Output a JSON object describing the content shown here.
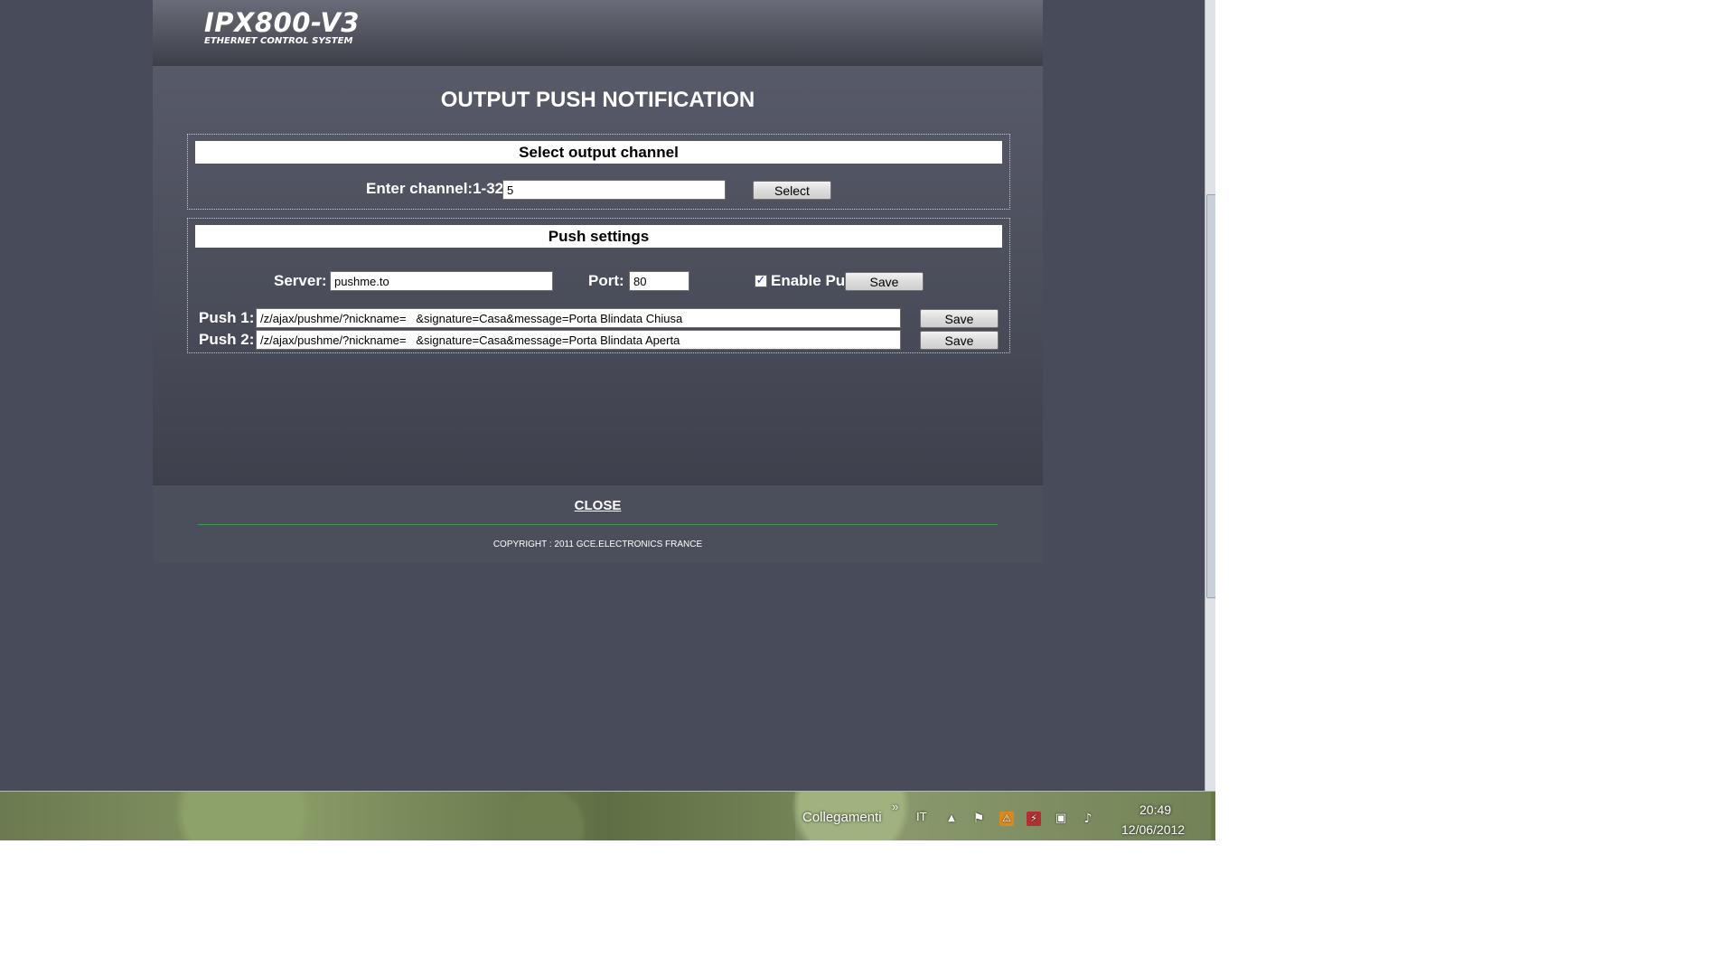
{
  "logo": {
    "title": "IPX800-V3",
    "subtitle": "ETHERNET CONTROL SYSTEM"
  },
  "page": {
    "title": "OUTPUT PUSH NOTIFICATION"
  },
  "channel_section": {
    "header": "Select output channel",
    "label": "Enter channel:1-32",
    "value": "5",
    "select_button": "Select"
  },
  "push_section": {
    "header": "Push settings",
    "server_label": "Server:",
    "server_value": "pushme.to",
    "port_label": "Port:",
    "port_value": "80",
    "enable_label": "Enable Push",
    "enable_checked": true,
    "save_button": "Save",
    "push1_label": "Push 1:",
    "push1_value": "/z/ajax/pushme/?nickname=   &signature=Casa&message=Porta Blindata Chiusa",
    "push1_save": "Save",
    "push2_label": "Push 2:",
    "push2_value": "/z/ajax/pushme/?nickname=   &signature=Casa&message=Porta Blindata Aperta",
    "push2_save": "Save"
  },
  "footer": {
    "close_link": "CLOSE",
    "copyright": "COPYRIGHT : 2011 GCE.ELECTRONICS FRANCE"
  },
  "taskbar": {
    "toolbar_label": "Collegamenti",
    "toolbar_chevron": "»",
    "language": "IT",
    "time": "20:49",
    "date": "12/06/2012",
    "tray_icons": [
      "show-hidden-icons",
      "action-center-flag",
      "antivirus",
      "power",
      "network",
      "volume"
    ]
  }
}
